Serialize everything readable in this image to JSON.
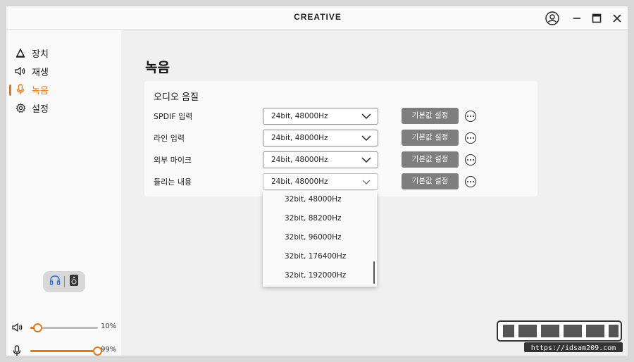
{
  "app": {
    "brand": "CREATIVE"
  },
  "titlebar": {
    "icons": [
      "account-icon",
      "minimize-icon",
      "maximize-icon",
      "close-icon"
    ]
  },
  "sidebar": {
    "items": [
      {
        "label": "장치",
        "icon": "device-icon"
      },
      {
        "label": "재생",
        "icon": "speaker-icon"
      },
      {
        "label": "녹음",
        "icon": "microphone-icon",
        "active": true
      },
      {
        "label": "설정",
        "icon": "gear-icon"
      }
    ],
    "output_switch": {
      "icons": [
        "headphones-icon",
        "speaker-box-icon"
      ],
      "selected": "headphones"
    },
    "volume": {
      "level": 10,
      "label": "10%"
    },
    "mic": {
      "level": 99,
      "label": "99%"
    }
  },
  "main": {
    "title": "녹음",
    "card": {
      "title": "오디오 음질",
      "rows": [
        {
          "label": "SPDIF 입력",
          "value": "24bit, 48000Hz",
          "button": "기본값 설정"
        },
        {
          "label": "라인 입력",
          "value": "24bit, 48000Hz",
          "button": "기본값 설정"
        },
        {
          "label": "외부 마이크",
          "value": "24bit, 48000Hz",
          "button": "기본값 설정"
        },
        {
          "label": "들리는 내용",
          "value": "24bit, 48000Hz",
          "button": "기본값 설정"
        }
      ]
    },
    "dropdown_options": [
      "32bit, 48000Hz",
      "32bit, 88200Hz",
      "32bit, 96000Hz",
      "32bit, 176400Hz",
      "32bit, 192000Hz"
    ]
  },
  "watermark": {
    "text": "https://idsam209.com"
  },
  "colors": {
    "accent": "#e07a1f",
    "button_gray": "#7e7e7e",
    "window_bg": "#f0f0f0"
  }
}
